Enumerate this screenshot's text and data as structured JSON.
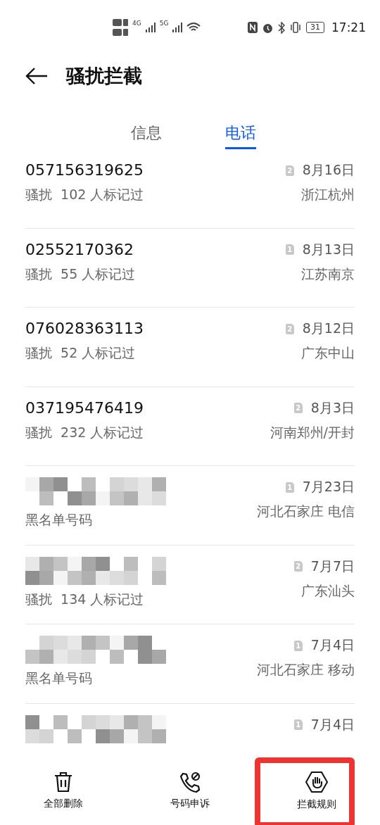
{
  "status_bar": {
    "signals": [
      {
        "label": "4G"
      },
      {
        "label": "5G"
      }
    ],
    "battery": "31",
    "time": "17:21"
  },
  "header": {
    "title": "骚扰拦截"
  },
  "tabs": [
    {
      "label": "信息",
      "selected": false
    },
    {
      "label": "电话",
      "selected": true
    }
  ],
  "calls": [
    {
      "kind": "number",
      "number": "057156319625",
      "note": "骚扰  102 人标记过",
      "sim": "2",
      "date": "8月16日",
      "location": "浙江杭州"
    },
    {
      "kind": "number",
      "number": "02552170362",
      "note": "骚扰  55 人标记过",
      "sim": "1",
      "date": "8月13日",
      "location": "江苏南京"
    },
    {
      "kind": "number",
      "number": "076028363113",
      "note": "骚扰  52 人标记过",
      "sim": "2",
      "date": "8月12日",
      "location": "广东中山"
    },
    {
      "kind": "number",
      "number": "037195476419",
      "note": "骚扰  232 人标记过",
      "sim": "2",
      "date": "8月3日",
      "location": "河南郑州/开封"
    },
    {
      "kind": "redacted",
      "note": "黑名单号码",
      "sim": "1",
      "date": "7月23日",
      "location": "河北石家庄 电信"
    },
    {
      "kind": "redacted",
      "note": "骚扰  134 人标记过",
      "sim": "2",
      "date": "7月7日",
      "location": "广东汕头"
    },
    {
      "kind": "redacted",
      "note": "黑名单号码",
      "sim": "1",
      "date": "7月4日",
      "location": "河北石家庄 移动"
    },
    {
      "kind": "redacted",
      "sim": "1",
      "date": "7月4日"
    }
  ],
  "toolbar": [
    {
      "kind": "delete",
      "label": "全部删除",
      "highlighted": false
    },
    {
      "kind": "appeal",
      "label": "号码申诉",
      "highlighted": false
    },
    {
      "kind": "rules",
      "label": "拦截规则",
      "highlighted": true
    }
  ]
}
